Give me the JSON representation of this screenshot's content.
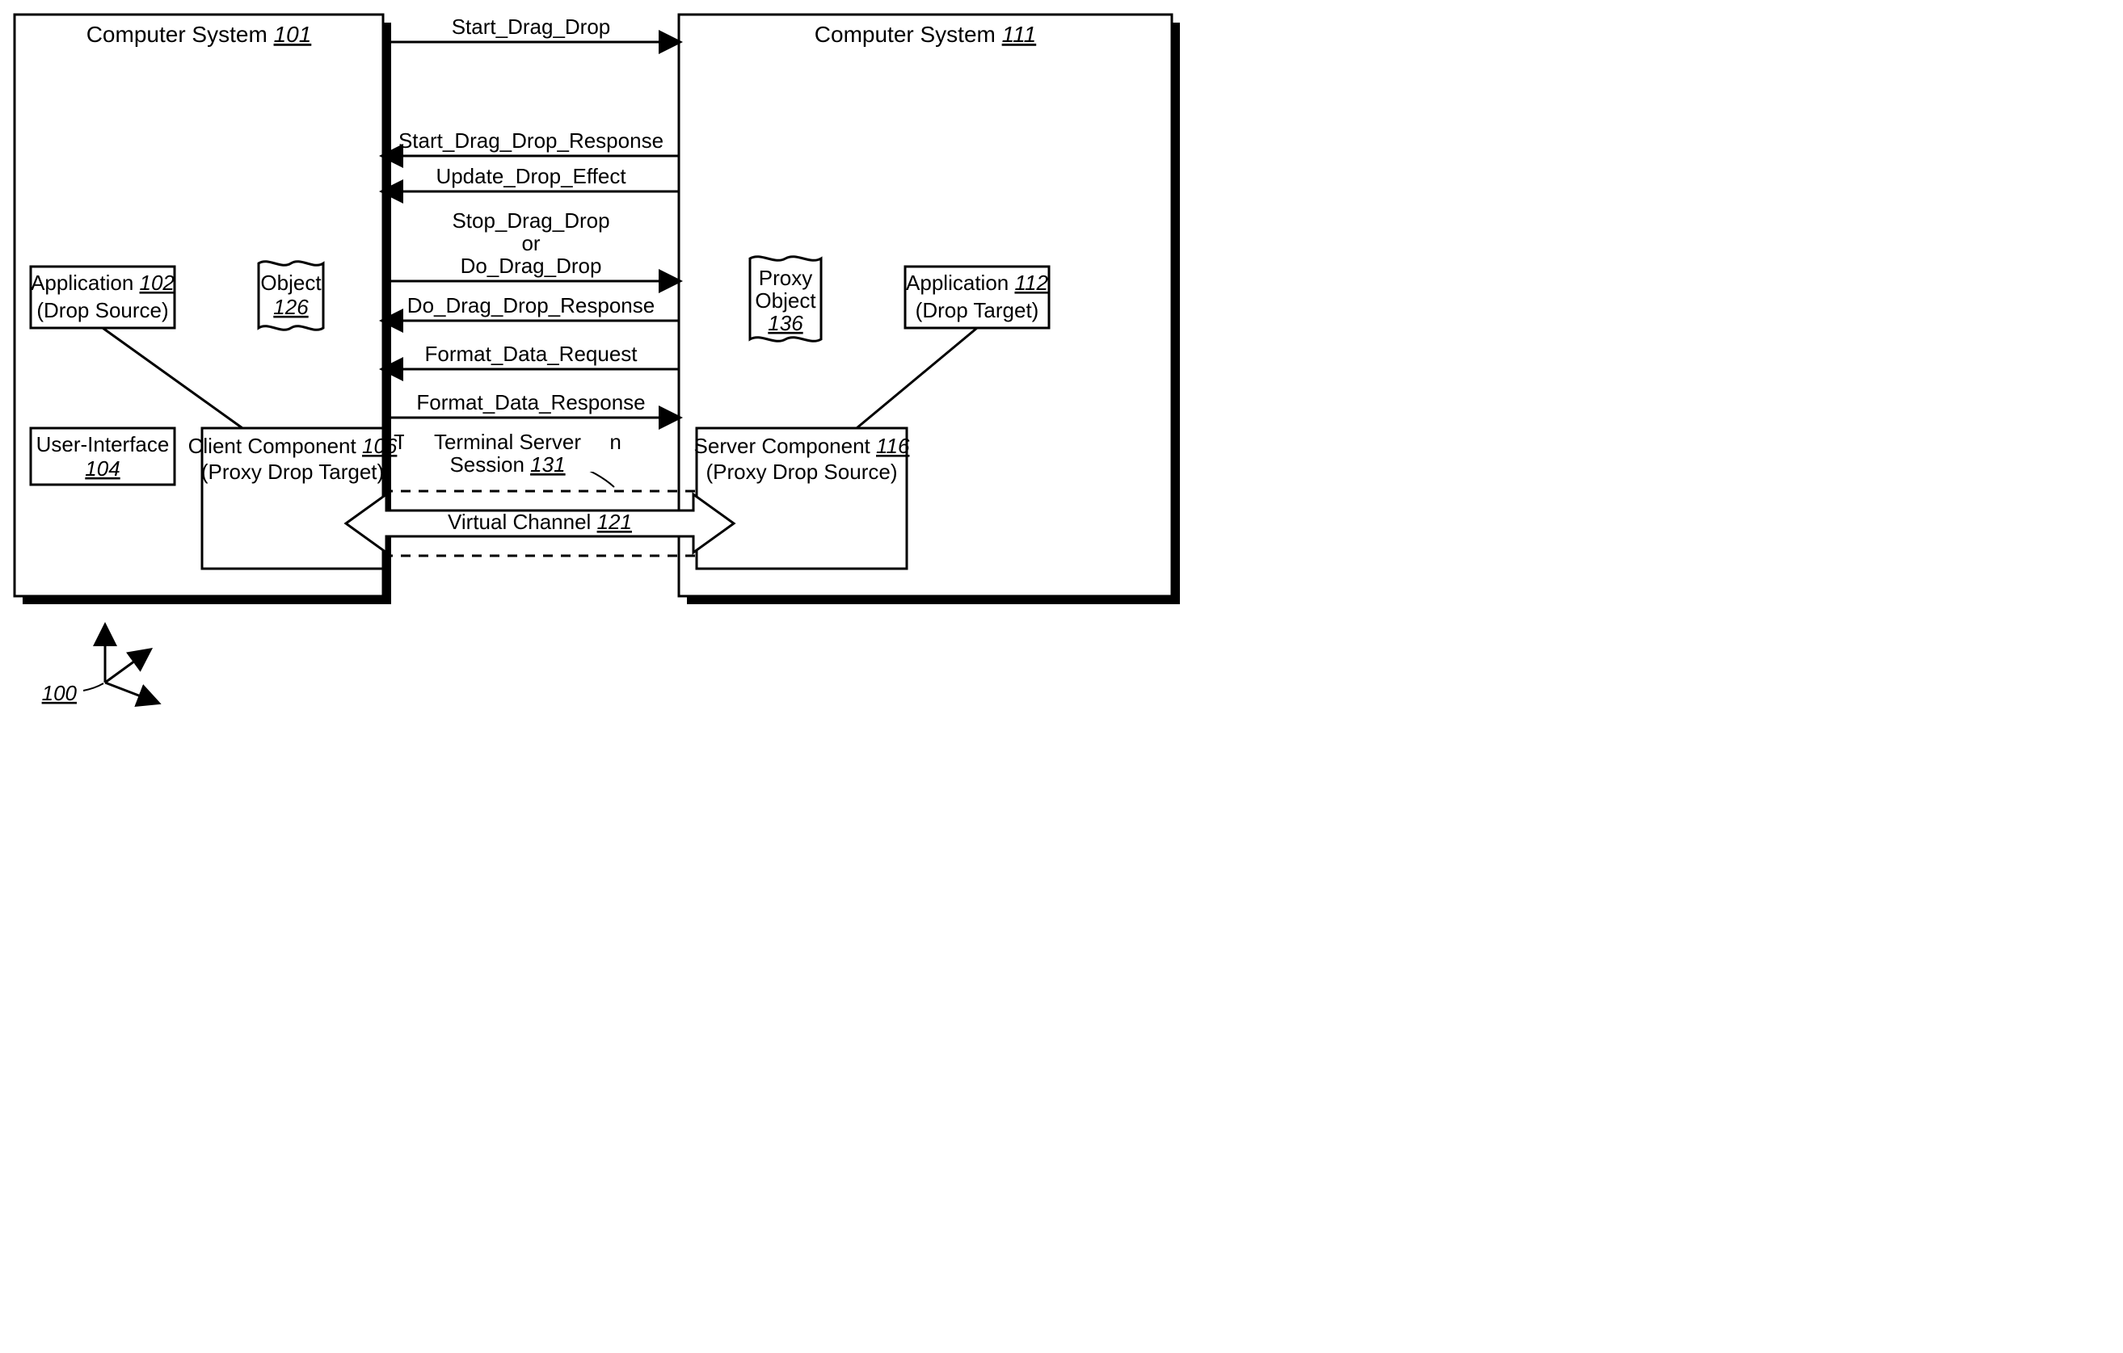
{
  "diagram_number": "100",
  "left": {
    "title": "Computer System",
    "title_num": "101",
    "app": {
      "label": "Application",
      "num": "102",
      "sub": "(Drop Source)"
    },
    "ui": {
      "label": "User-Interface",
      "num": "104"
    },
    "comp": {
      "label": "Client Component",
      "num": "106",
      "sub": "(Proxy Drop Target)"
    },
    "obj": {
      "label": "Object",
      "num": "126"
    }
  },
  "right": {
    "title": "Computer System",
    "title_num": "111",
    "app": {
      "label": "Application",
      "num": "112",
      "sub": "(Drop Target)"
    },
    "comp": {
      "label": "Server Component",
      "num": "116",
      "sub": "(Proxy Drop Source)"
    },
    "obj": {
      "label1": "Proxy",
      "label2": "Object",
      "num": "136"
    }
  },
  "messages": {
    "m1": "Start_Drag_Drop",
    "m2": "Start_Drag_Drop_Response",
    "m3": "Update_Drop_Effect",
    "m4a": "Stop_Drag_Drop",
    "m4b": "or",
    "m4c": "Do_Drag_Drop",
    "m5": "Do_Drag_Drop_Response",
    "m6": "Format_Data_Request",
    "m7": "Format_Data_Response"
  },
  "session": {
    "label": "Terminal Server Session",
    "num": "131"
  },
  "channel": {
    "label": "Virtual Channel",
    "num": "121"
  }
}
